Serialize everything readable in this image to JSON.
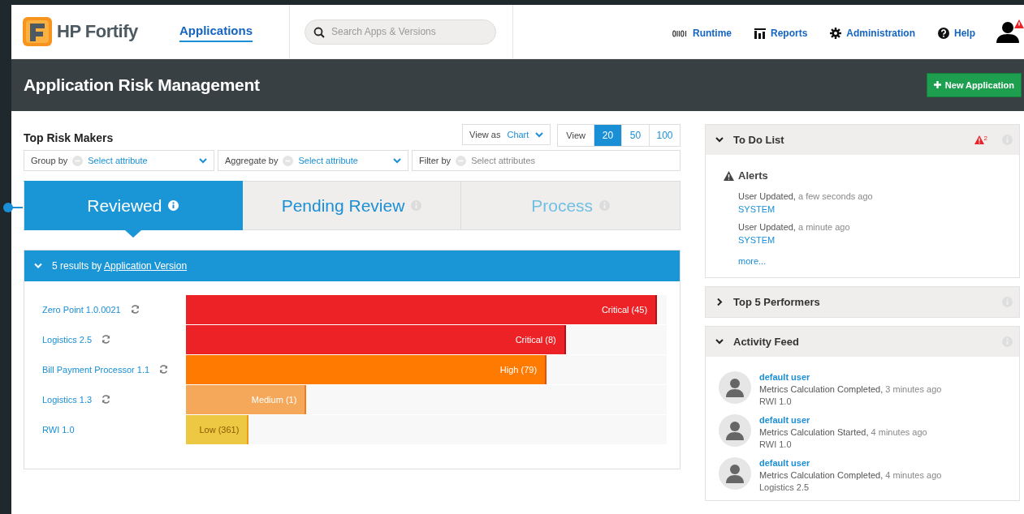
{
  "header": {
    "logo": "HP Fortify",
    "nav": [
      {
        "label": "Applications",
        "selected": true
      }
    ],
    "search": {
      "placeholder": "Search Apps & Versions"
    },
    "links": [
      {
        "kind": "runtime",
        "label": "Runtime"
      },
      {
        "kind": "reports",
        "label": "Reports"
      },
      {
        "kind": "admin",
        "label": "Administration"
      },
      {
        "kind": "help",
        "label": "Help"
      }
    ],
    "user_alert": true
  },
  "title_bar": {
    "title": "Application Risk Management",
    "button": "New Application"
  },
  "risk": {
    "title": "Top Risk Makers",
    "view_as": {
      "label": "View as",
      "value": "Chart"
    },
    "view": {
      "label": "View",
      "options": [
        {
          "label": "20",
          "selected": true
        },
        {
          "label": "50",
          "selected": false
        },
        {
          "label": "100",
          "selected": false
        }
      ]
    },
    "filters": [
      {
        "label": "Group by",
        "placeholder": "Select attribute",
        "dropdown": true
      },
      {
        "label": "Aggregate by",
        "placeholder": "Select attribute",
        "dropdown": true
      },
      {
        "label": "Filter by",
        "placeholder": "Select attributes",
        "dropdown": false
      }
    ],
    "tabs": [
      {
        "label": "Reviewed",
        "selected": true,
        "disabled": false
      },
      {
        "label": "Pending Review",
        "selected": false,
        "disabled": false
      },
      {
        "label": "Process",
        "selected": false,
        "disabled": true
      }
    ],
    "results": {
      "prefix": "5 results by",
      "link": "Application Version",
      "expanded": true
    },
    "rows": [
      {
        "name": "Zero Point 1.0.0021",
        "refresh": true,
        "kind": "critical",
        "label": "Critical (45)",
        "level": 0.98
      },
      {
        "name": "Logistics 2.5",
        "refresh": true,
        "kind": "critical",
        "label": "Critical (8)",
        "level": 0.79
      },
      {
        "name": "Bill Payment Processor 1.1",
        "refresh": true,
        "kind": "high",
        "label": "High (79)",
        "level": 0.75
      },
      {
        "name": "Logistics 1.3",
        "refresh": true,
        "kind": "medium",
        "label": "Medium (1)",
        "level": 0.25
      },
      {
        "name": "RWI 1.0",
        "refresh": false,
        "kind": "low",
        "label": "Low (361)",
        "level": 0.13
      }
    ]
  },
  "panels": [
    {
      "kind": "todo",
      "title": "To Do List",
      "expanded": true,
      "badge": "2",
      "heading": "Alerts",
      "alerts": [
        {
          "event": "User Updated,",
          "time": "a few seconds ago",
          "user": "SYSTEM"
        },
        {
          "event": "User Updated,",
          "time": "a minute ago",
          "user": "SYSTEM"
        }
      ],
      "more": "more..."
    },
    {
      "title": "Top 5 Performers",
      "expanded": false
    },
    {
      "kind": "activity",
      "title": "Activity Feed",
      "expanded": true,
      "items": [
        {
          "user": "default user",
          "event": "Metrics Calculation Completed,",
          "time": "3 minutes ago",
          "target": "RWI 1.0"
        },
        {
          "user": "default user",
          "event": "Metrics Calculation Started,",
          "time": "4 minutes ago",
          "target": "RWI 1.0"
        },
        {
          "user": "default user",
          "event": "Metrics Calculation Completed,",
          "time": "4 minutes ago",
          "target": "Logistics 2.5"
        }
      ]
    }
  ]
}
